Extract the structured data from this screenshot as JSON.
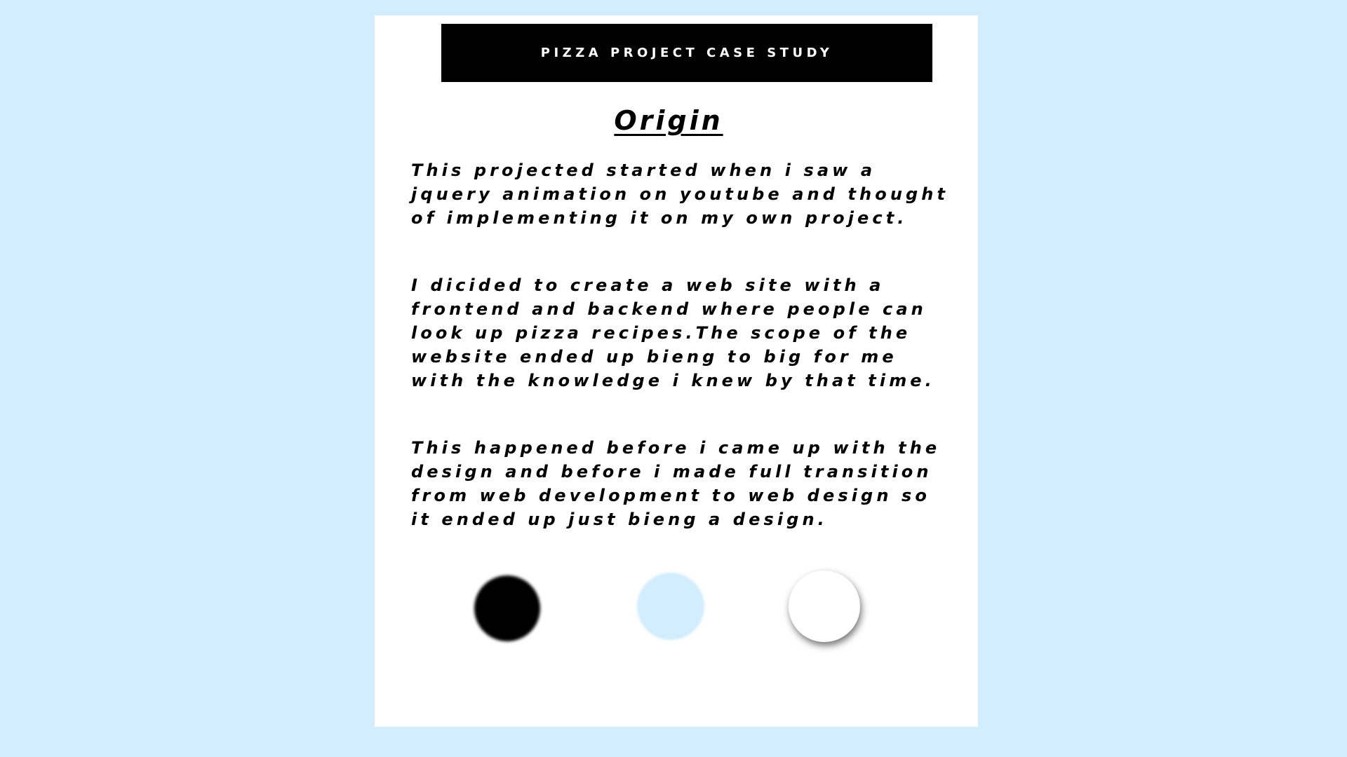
{
  "colors": {
    "background": "#d2edfd",
    "card": "#ffffff",
    "banner": "#000000",
    "text": "#000000"
  },
  "banner": {
    "title": "PIZZA PROJECT CASE STUDY"
  },
  "section": {
    "heading": "Origin",
    "paragraphs": [
      "This projected started when i saw a\njquery animation on youtube and thought\nof implementing it on my own project.",
      "I dicided to create a web site with a\nfrontend and backend where people can\nlook up pizza recipes.The scope of the\nwebsite ended up bieng to big for me\nwith the knowledge i knew by that time.",
      "This happened before i came up with the\ndesign and before i made full  transition\nfrom web development to web design so\nit ended up just bieng a design."
    ]
  },
  "palette": [
    {
      "name": "black",
      "color": "#000000"
    },
    {
      "name": "light-blue",
      "color": "#d2edfd"
    },
    {
      "name": "white",
      "color": "#ffffff"
    }
  ]
}
